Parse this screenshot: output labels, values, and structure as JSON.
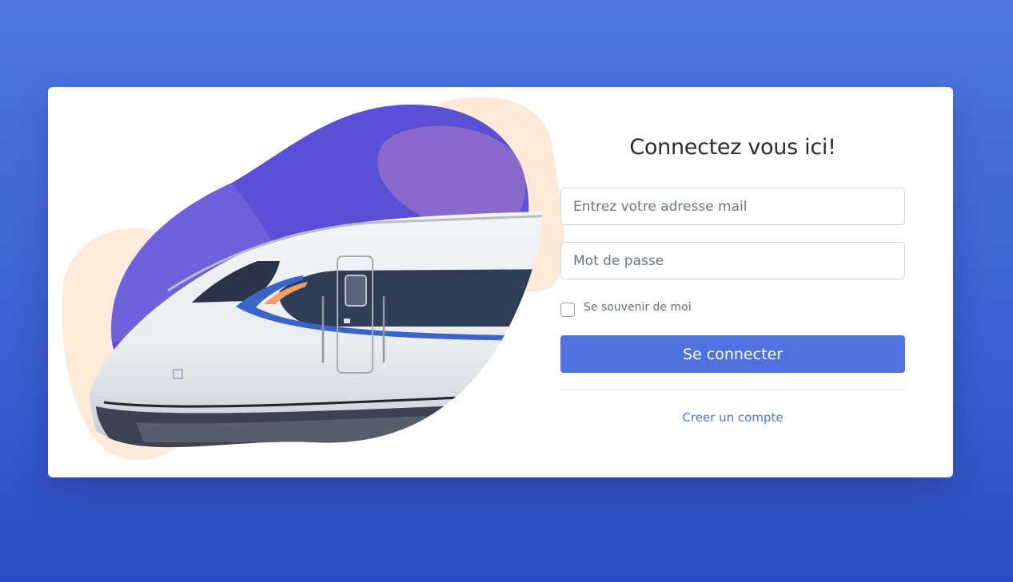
{
  "login": {
    "title": "Connectez vous ici!",
    "email_placeholder": "Entrez votre adresse mail",
    "password_placeholder": "Mot de passe",
    "remember_label": "Se souvenir de moi",
    "submit_label": "Se connecter",
    "create_account_label": "Creer un compte"
  },
  "colors": {
    "background_top": "#4f77e0",
    "background_bottom": "#2b4fc4",
    "primary_button": "#4f72df",
    "link": "#4e73df",
    "blob_purple": "#5b4fd6",
    "blob_peach": "#fde8d6"
  }
}
